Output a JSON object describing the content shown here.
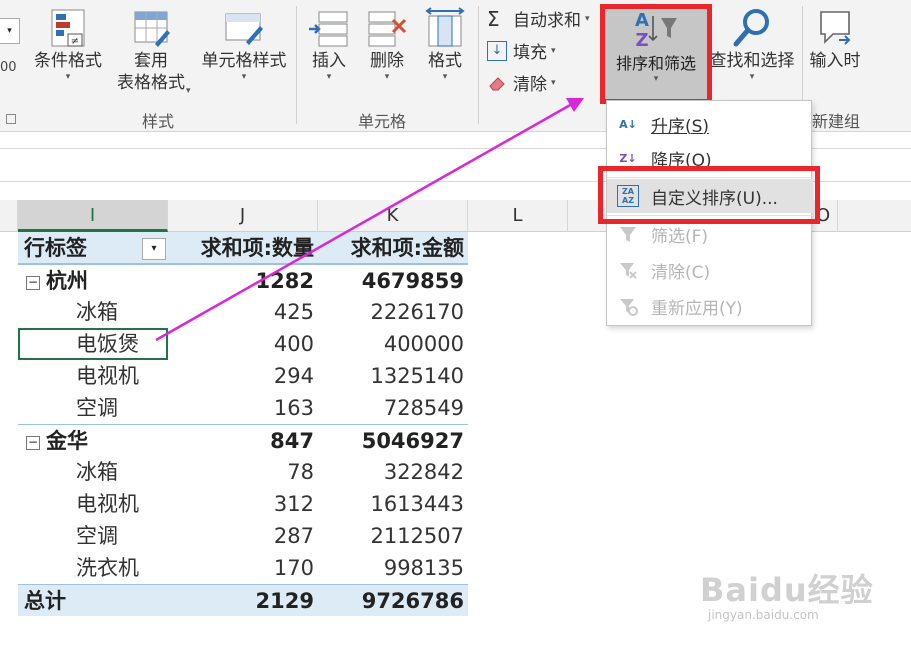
{
  "ribbon": {
    "left_partial": "00",
    "styles_group": {
      "label": "样式",
      "conditional_format": "条件格式",
      "table_format_line1": "套用",
      "table_format_line2": "表格格式",
      "cell_style": "单元格样式"
    },
    "cells_group": {
      "label": "单元格",
      "insert": "插入",
      "delete": "删除",
      "format": "格式"
    },
    "editing_group": {
      "autosum": "自动求和",
      "fill": "填充",
      "clear": "清除",
      "sort_filter": "排序和筛选",
      "find_select": "查找和选择"
    },
    "new_group": {
      "label": "新建组",
      "input_time": "输入时"
    }
  },
  "columns": [
    "I",
    "J",
    "K",
    "L",
    "O"
  ],
  "pivot": {
    "header": {
      "row_label": "行标签",
      "sum_qty": "求和项:数量",
      "sum_amount": "求和项:金额"
    },
    "groups": [
      {
        "name": "杭州",
        "qty": "1282",
        "amount": "4679859",
        "items": [
          {
            "name": "冰箱",
            "qty": "425",
            "amount": "2226170"
          },
          {
            "name": "电饭煲",
            "qty": "400",
            "amount": "400000"
          },
          {
            "name": "电视机",
            "qty": "294",
            "amount": "1325140"
          },
          {
            "name": "空调",
            "qty": "163",
            "amount": "728549"
          }
        ]
      },
      {
        "name": "金华",
        "qty": "847",
        "amount": "5046927",
        "items": [
          {
            "name": "冰箱",
            "qty": "78",
            "amount": "322842"
          },
          {
            "name": "电视机",
            "qty": "312",
            "amount": "1613443"
          },
          {
            "name": "空调",
            "qty": "287",
            "amount": "2112507"
          },
          {
            "name": "洗衣机",
            "qty": "170",
            "amount": "998135"
          }
        ]
      }
    ],
    "total": {
      "label": "总计",
      "qty": "2129",
      "amount": "9726786"
    }
  },
  "menu": {
    "sort_asc": "升序(S)",
    "sort_desc": "降序(O)",
    "custom_sort": "自定义排序(U)...",
    "filter": "筛选(F)",
    "clear": "清除(C)",
    "reapply": "重新应用(Y)"
  },
  "watermark": {
    "brand": "Baidu经验",
    "url": "jingyan.baidu.com"
  },
  "colors": {
    "highlight_red": "#e8262b",
    "arrow_magenta": "#d926d9",
    "excel_green": "#217346",
    "pivot_header": "#ddebf7"
  }
}
